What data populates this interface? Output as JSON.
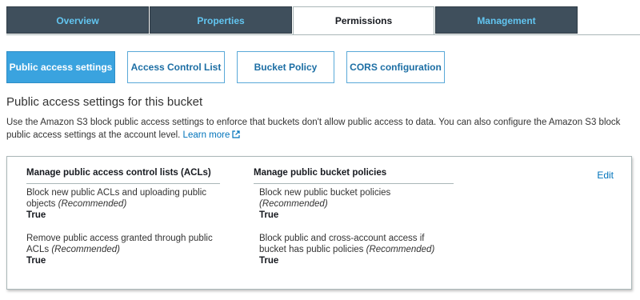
{
  "tabs": [
    {
      "label": "Overview",
      "active": false
    },
    {
      "label": "Properties",
      "active": false
    },
    {
      "label": "Permissions",
      "active": true
    },
    {
      "label": "Management",
      "active": false
    }
  ],
  "subnav": {
    "public_access": "Public access settings",
    "acl": "Access Control List",
    "bucket_policy": "Bucket Policy",
    "cors": "CORS configuration"
  },
  "section": {
    "title": "Public access settings for this bucket",
    "description": "Use the Amazon S3 block public access settings to enforce that buckets don't allow public access to data. You can also configure the Amazon S3 block public access settings at the account level.",
    "learn_more": "Learn more"
  },
  "panel": {
    "edit": "Edit",
    "acls": {
      "heading": "Manage public access control lists (ACLs)",
      "items": [
        {
          "text": "Block new public ACLs and uploading public objects",
          "note": "(Recommended)",
          "value": "True"
        },
        {
          "text": "Remove public access granted through public ACLs",
          "note": "(Recommended)",
          "value": "True"
        }
      ]
    },
    "policies": {
      "heading": "Manage public bucket policies",
      "items": [
        {
          "text": "Block new public bucket policies",
          "note": "(Recommended)",
          "value": "True"
        },
        {
          "text": "Block public and cross-account access if bucket has public policies",
          "note": "(Recommended)",
          "value": "True"
        }
      ]
    }
  },
  "colors": {
    "tab_inactive_bg": "#3f4f5c",
    "tab_inactive_text": "#62c5f0",
    "primary_button": "#3aa3df",
    "link": "#0073bb"
  }
}
